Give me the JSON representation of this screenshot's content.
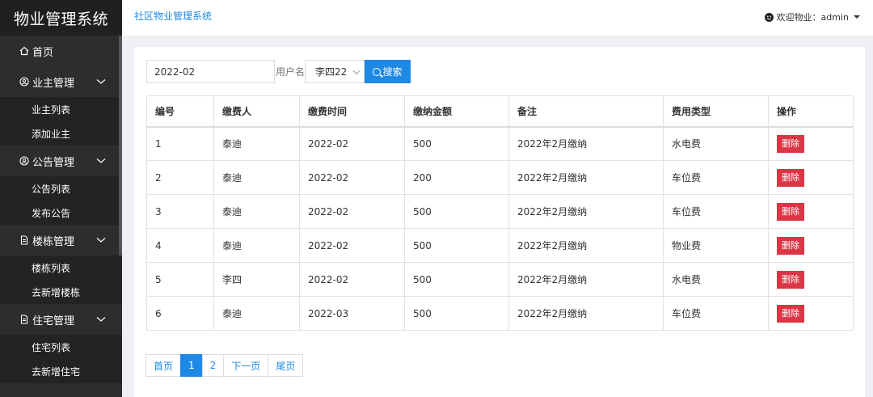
{
  "sidebar": {
    "logo": "物业管理系统",
    "home": "首页",
    "groups": [
      {
        "label": "业主管理",
        "items": [
          "业主列表",
          "添加业主"
        ]
      },
      {
        "label": "公告管理",
        "items": [
          "公告列表",
          "发布公告"
        ]
      },
      {
        "label": "楼栋管理",
        "items": [
          "楼栋列表",
          "去新增楼栋"
        ]
      },
      {
        "label": "住宅管理",
        "items": [
          "住宅列表",
          "去新增住宅"
        ]
      }
    ]
  },
  "header": {
    "brand": "社区物业管理系统",
    "welcome": "欢迎物业：admin"
  },
  "search": {
    "date_value": "2022-02",
    "username_label": "用户名",
    "user_selected": "李四22",
    "button": "搜索"
  },
  "table": {
    "columns": [
      "编号",
      "缴费人",
      "缴费时间",
      "缴纳金额",
      "备注",
      "费用类型",
      "操作"
    ],
    "rows": [
      [
        "1",
        "泰迪",
        "2022-02",
        "500",
        "2022年2月缴纳",
        "水电费"
      ],
      [
        "2",
        "泰迪",
        "2022-02",
        "200",
        "2022年2月缴纳",
        "车位费"
      ],
      [
        "3",
        "泰迪",
        "2022-02",
        "500",
        "2022年2月缴纳",
        "车位费"
      ],
      [
        "4",
        "泰迪",
        "2022-02",
        "500",
        "2022年2月缴纳",
        "物业费"
      ],
      [
        "5",
        "李四",
        "2022-02",
        "500",
        "2022年2月缴纳",
        "水电费"
      ],
      [
        "6",
        "泰迪",
        "2022-03",
        "500",
        "2022年2月缴纳",
        "车位费"
      ]
    ],
    "delete_label": "删除"
  },
  "pager": {
    "first": "首页",
    "pages": [
      "1",
      "2"
    ],
    "current": "1",
    "next": "下一页",
    "last": "尾页"
  },
  "colors": {
    "accent": "#1e88e5",
    "danger": "#dc3545",
    "sidebar_bg": "#2d2d2d"
  }
}
